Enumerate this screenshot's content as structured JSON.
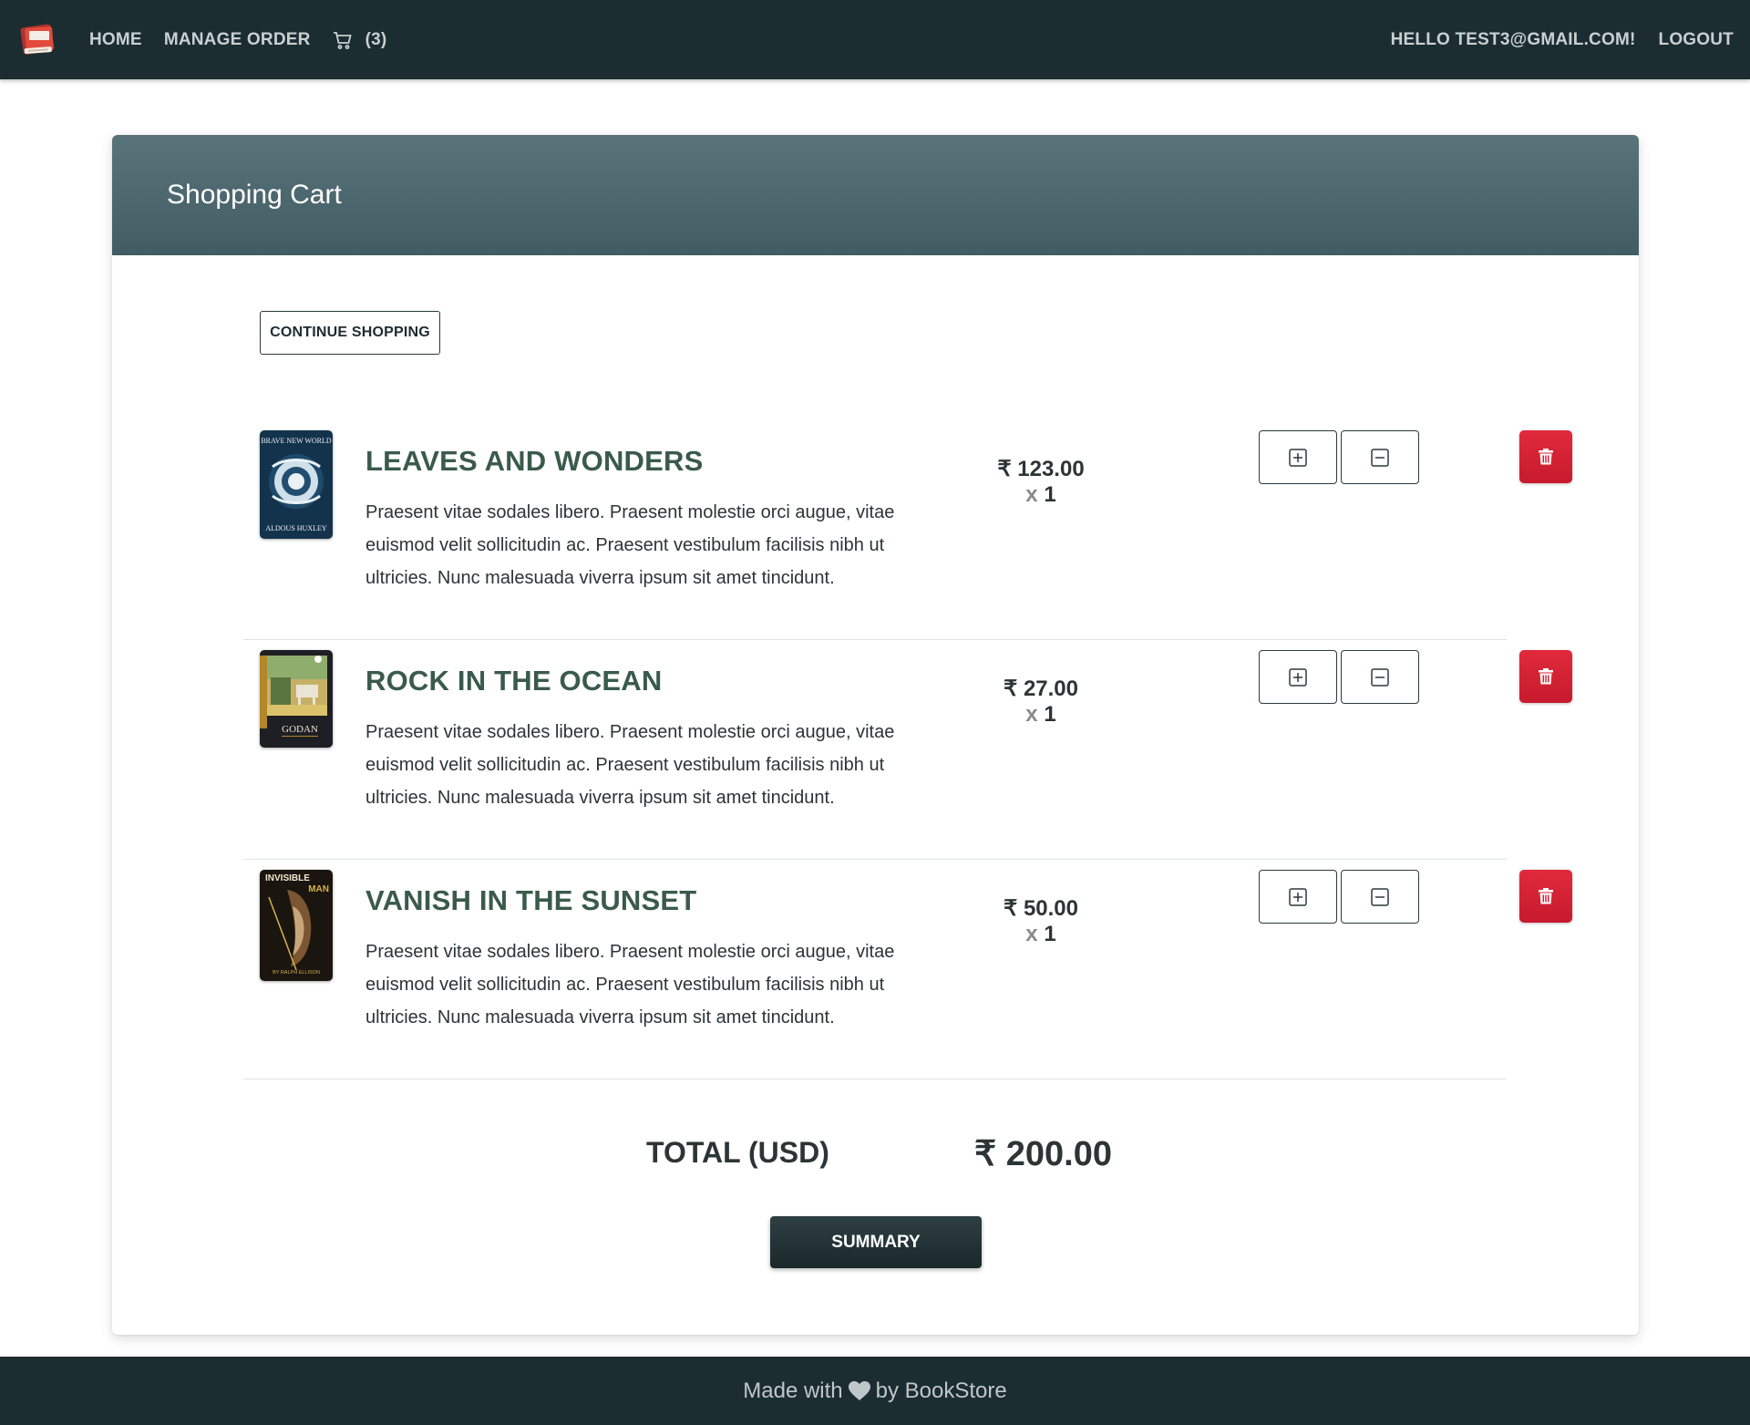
{
  "nav": {
    "home_label": "HOME",
    "manage_order_label": "MANAGE ORDER",
    "cart_count": "(3)",
    "greeting": "HELLO TEST3@GMAIL.COM!",
    "logout_label": "LOGOUT"
  },
  "page": {
    "title": "Shopping Cart",
    "continue_label": "CONTINUE SHOPPING"
  },
  "items": [
    {
      "name": "LEAVES AND WONDERS",
      "description": "Praesent vitae sodales libero. Praesent molestie orci augue, vitae euismod velit sollicitudin ac. Praesent vestibulum facilisis nibh ut ultricies. Nunc malesuada viverra ipsum sit amet tincidunt.",
      "price": "₹ 123.00",
      "qty_prefix": "x",
      "qty": "1",
      "cover": {
        "title_top": "BRAVE NEW WORLD",
        "author": "ALDOUS HUXLEY"
      }
    },
    {
      "name": "ROCK IN THE OCEAN",
      "description": "Praesent vitae sodales libero. Praesent molestie orci augue, vitae euismod velit sollicitudin ac. Praesent vestibulum facilisis nibh ut ultricies. Nunc malesuada viverra ipsum sit amet tincidunt.",
      "price": "₹ 27.00",
      "qty_prefix": "x",
      "qty": "1",
      "cover": {
        "title_top": "GODAN"
      }
    },
    {
      "name": "VANISH IN THE SUNSET",
      "description": "Praesent vitae sodales libero. Praesent molestie orci augue, vitae euismod velit sollicitudin ac. Praesent vestibulum facilisis nibh ut ultricies. Nunc malesuada viverra ipsum sit amet tincidunt.",
      "price": "₹ 50.00",
      "qty_prefix": "x",
      "qty": "1",
      "cover": {
        "title_top": "INVISIBLE",
        "title_bottom": "MAN",
        "author": "BY RALPH ELLISON"
      }
    }
  ],
  "total": {
    "label": "TOTAL (USD)",
    "value": "₹ 200.00"
  },
  "summary_label": "SUMMARY",
  "footer": {
    "prefix": "Made with",
    "suffix": "by BookStore"
  },
  "icons": {
    "logo": "book-logo-icon",
    "cart": "cart-icon",
    "plus": "plus-square-icon",
    "minus": "minus-square-icon",
    "delete": "trash-icon",
    "heart": "heart-icon"
  },
  "colors": {
    "navbar": "#1c2d31",
    "header_gradient_top": "#59737a",
    "header_gradient_bottom": "#415c63",
    "item_title": "#3a5a4c",
    "delete": "#d32235"
  }
}
